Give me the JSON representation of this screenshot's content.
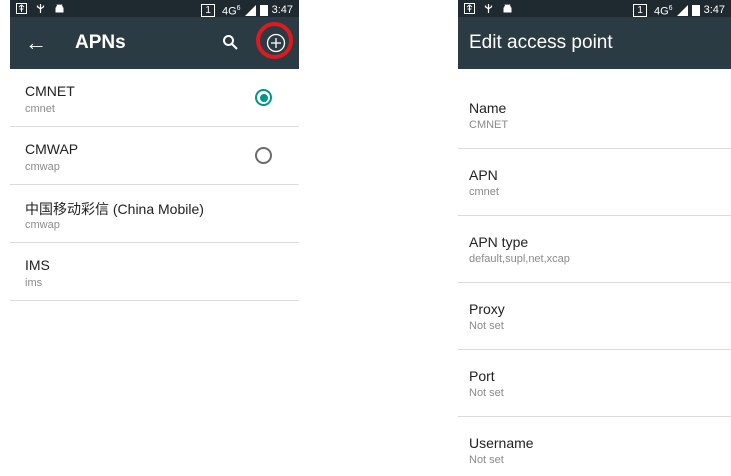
{
  "left_screen": {
    "status_bar": {
      "sim_slot": "1",
      "network": "4G",
      "network_sup": "6",
      "time": "3:47"
    },
    "app_bar": {
      "title": "APNs",
      "back_icon": "back-arrow-icon",
      "search_icon": "search-icon",
      "add_icon": "add-circle-icon"
    },
    "highlight_color": "#e3181d",
    "apns": [
      {
        "name": "CMNET",
        "value": "cmnet",
        "radio": "checked"
      },
      {
        "name": "CMWAP",
        "value": "cmwap",
        "radio": "unchecked"
      },
      {
        "name": "中国移动彩信 (China Mobile)",
        "value": "cmwap",
        "radio": "none"
      },
      {
        "name": "IMS",
        "value": "ims",
        "radio": "none"
      }
    ]
  },
  "right_screen": {
    "status_bar": {
      "sim_slot": "1",
      "network": "4G",
      "network_sup": "6",
      "time": "3:47"
    },
    "app_bar": {
      "title": "Edit access point"
    },
    "fields": [
      {
        "title": "Name",
        "value": "CMNET"
      },
      {
        "title": "APN",
        "value": "cmnet"
      },
      {
        "title": "APN type",
        "value": "default,supl,net,xcap"
      },
      {
        "title": "Proxy",
        "value": "Not set"
      },
      {
        "title": "Port",
        "value": "Not set"
      },
      {
        "title": "Username",
        "value": "Not set"
      }
    ]
  },
  "colors": {
    "status_bar": "#1e2a30",
    "app_bar": "#2b3b43",
    "accent": "#009688"
  }
}
